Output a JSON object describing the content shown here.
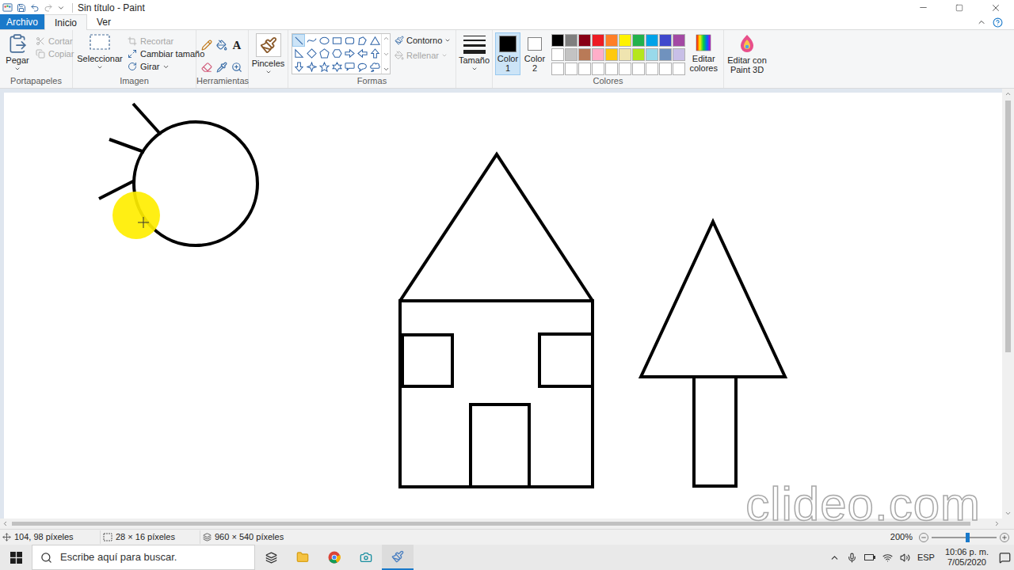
{
  "window": {
    "title": "Sin título - Paint"
  },
  "menu_tabs": [
    {
      "label": "Archivo",
      "selected": false,
      "kind": "file"
    },
    {
      "label": "Inicio",
      "selected": true,
      "kind": "tab"
    },
    {
      "label": "Ver",
      "selected": false,
      "kind": "tab"
    }
  ],
  "ribbon": {
    "clipboard": {
      "label": "Portapapeles",
      "paste": "Pegar",
      "actions": [
        {
          "label": "Cortar",
          "disabled": true,
          "kind": "cut"
        },
        {
          "label": "Copiar",
          "disabled": true,
          "kind": "copy"
        }
      ]
    },
    "image": {
      "label": "Imagen",
      "select": "Seleccionar",
      "actions": [
        {
          "label": "Recortar",
          "disabled": true,
          "kind": "crop"
        },
        {
          "label": "Cambiar tamaño",
          "disabled": false,
          "kind": "resize"
        },
        {
          "label": "Girar",
          "disabled": false,
          "kind": "rotate"
        }
      ]
    },
    "tools": {
      "label": "Herramientas",
      "text_tool": "A"
    },
    "brushes": {
      "label": "Pinceles"
    },
    "shapes": {
      "label": "Formas",
      "items": [
        {
          "kind": "line",
          "selected": true
        },
        {
          "kind": "curve",
          "selected": false
        },
        {
          "kind": "oval",
          "selected": false
        },
        {
          "kind": "rect",
          "selected": false
        },
        {
          "kind": "roundrect",
          "selected": false
        },
        {
          "kind": "polygon",
          "selected": false
        },
        {
          "kind": "triangle",
          "selected": false
        },
        {
          "kind": "righttriangle",
          "selected": false
        },
        {
          "kind": "diamond",
          "selected": false
        },
        {
          "kind": "pentagon",
          "selected": false
        },
        {
          "kind": "hexagon",
          "selected": false
        },
        {
          "kind": "arrowright",
          "selected": false
        },
        {
          "kind": "arrowleft",
          "selected": false
        },
        {
          "kind": "arrowup",
          "selected": false
        },
        {
          "kind": "arrowdown",
          "selected": false
        },
        {
          "kind": "star4",
          "selected": false
        },
        {
          "kind": "star5",
          "selected": false
        },
        {
          "kind": "star6",
          "selected": false
        },
        {
          "kind": "calloutrect",
          "selected": false
        },
        {
          "kind": "calloutoval",
          "selected": false
        },
        {
          "kind": "calloutcloud",
          "selected": false
        }
      ],
      "outline": {
        "label": "Contorno",
        "disabled": false
      },
      "fill": {
        "label": "Rellenar",
        "disabled": true
      }
    },
    "size": {
      "label": "Tamaño"
    },
    "colors": {
      "label": "Colores",
      "color1": {
        "label": "Color 1",
        "color": "#000000",
        "selected": true
      },
      "color2": {
        "label": "Color 2",
        "color": "#ffffff",
        "selected": false
      },
      "palette": [
        {
          "color": "#000000"
        },
        {
          "color": "#7f7f7f"
        },
        {
          "color": "#880015"
        },
        {
          "color": "#ed1c24"
        },
        {
          "color": "#ff7f27"
        },
        {
          "color": "#fff200"
        },
        {
          "color": "#22b14c"
        },
        {
          "color": "#00a2e8"
        },
        {
          "color": "#3f48cc"
        },
        {
          "color": "#a349a4"
        },
        {
          "color": "#ffffff"
        },
        {
          "color": "#c3c3c3"
        },
        {
          "color": "#b97a57"
        },
        {
          "color": "#ffaec9"
        },
        {
          "color": "#ffc90e"
        },
        {
          "color": "#efe4b0"
        },
        {
          "color": "#b5e61d"
        },
        {
          "color": "#99d9ea"
        },
        {
          "color": "#7092be"
        },
        {
          "color": "#c8bfe7"
        },
        {
          "color": "#ffffff"
        },
        {
          "color": "#ffffff"
        },
        {
          "color": "#ffffff"
        },
        {
          "color": "#ffffff"
        },
        {
          "color": "#ffffff"
        },
        {
          "color": "#ffffff"
        },
        {
          "color": "#ffffff"
        },
        {
          "color": "#ffffff"
        },
        {
          "color": "#ffffff"
        },
        {
          "color": "#ffffff"
        }
      ],
      "edit": "Editar colores"
    },
    "paint3d": {
      "label": "Editar con Paint 3D"
    }
  },
  "scrollbars": {
    "vertical": {
      "level": 0.62
    },
    "horizontal": {
      "level": 0.98
    }
  },
  "status_bar": {
    "cursor": "104, 98 píxeles",
    "selection": "28 × 16 píxeles",
    "canvas_size": "960 × 540 píxeles",
    "zoom": "200%",
    "zoom_level": 0.55
  },
  "taskbar": {
    "search_placeholder": "Escribe aquí para buscar.",
    "language": "ESP",
    "time": "10:06 p. m.",
    "date": "7/05/2020"
  },
  "watermark": "clideo.com"
}
